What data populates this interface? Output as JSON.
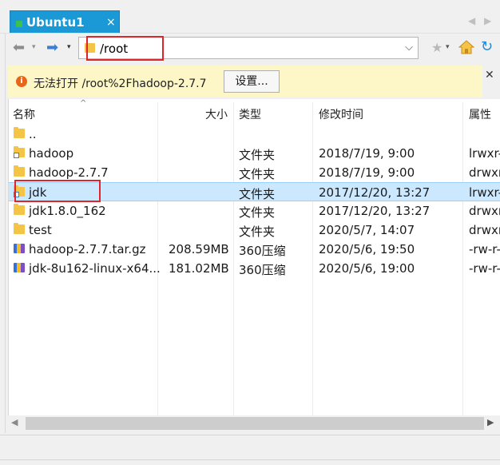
{
  "colors": {
    "tab_active": "#1b98d6",
    "notice_bg": "#fdf7c8",
    "selection": "#cce8ff",
    "highlight_box": "#e0252a",
    "folder": "#f4c446"
  },
  "tab": {
    "title": "Ubuntu1",
    "close": "×"
  },
  "tab_scroll": {
    "left": "◀",
    "right": "▶"
  },
  "toolbar": {
    "back_icon": "arrow-left-icon",
    "forward_icon": "arrow-right-icon",
    "back_glyph": "⬅",
    "forward_glyph": "➡",
    "dropdown_glyph": "▾",
    "address": "/root",
    "address_dropdown": "⌵",
    "bookmark_glyph": "★",
    "refresh_glyph": "↻"
  },
  "notice": {
    "icon": "i",
    "message": "无法打开 /root%2Fhadoop-2.7.7",
    "button": "设置...",
    "close": "✕"
  },
  "columns": {
    "name": "名称",
    "size": "大小",
    "type": "类型",
    "modified": "修改时间",
    "attributes": "属性"
  },
  "files": [
    {
      "icon": "folder-up-icon",
      "name": "..",
      "size": "",
      "type": "",
      "modified": "",
      "attributes": ""
    },
    {
      "icon": "folder-link-icon",
      "name": "hadoop",
      "size": "",
      "type": "文件夹",
      "modified": "2018/7/19, 9:00",
      "attributes": "lrwxr-"
    },
    {
      "icon": "folder-icon",
      "name": "hadoop-2.7.7",
      "size": "",
      "type": "文件夹",
      "modified": "2018/7/19, 9:00",
      "attributes": "drwxr"
    },
    {
      "icon": "folder-link-icon",
      "name": "jdk",
      "size": "",
      "type": "文件夹",
      "modified": "2017/12/20, 13:27",
      "attributes": "lrwxr-"
    },
    {
      "icon": "folder-icon",
      "name": "jdk1.8.0_162",
      "size": "",
      "type": "文件夹",
      "modified": "2017/12/20, 13:27",
      "attributes": "drwxr"
    },
    {
      "icon": "folder-icon",
      "name": "test",
      "size": "",
      "type": "文件夹",
      "modified": "2020/5/7, 14:07",
      "attributes": "drwxr"
    },
    {
      "icon": "archive-icon",
      "name": "hadoop-2.7.7.tar.gz",
      "size": "208.59MB",
      "type": "360压缩",
      "modified": "2020/5/6, 19:50",
      "attributes": "-rw-r-"
    },
    {
      "icon": "archive-icon",
      "name": "jdk-8u162-linux-x64...",
      "size": "181.02MB",
      "type": "360压缩",
      "modified": "2020/5/6, 19:00",
      "attributes": "-rw-r-"
    }
  ],
  "selected_row": "jdk",
  "scroll": {
    "left": "◀",
    "right": "▶"
  }
}
